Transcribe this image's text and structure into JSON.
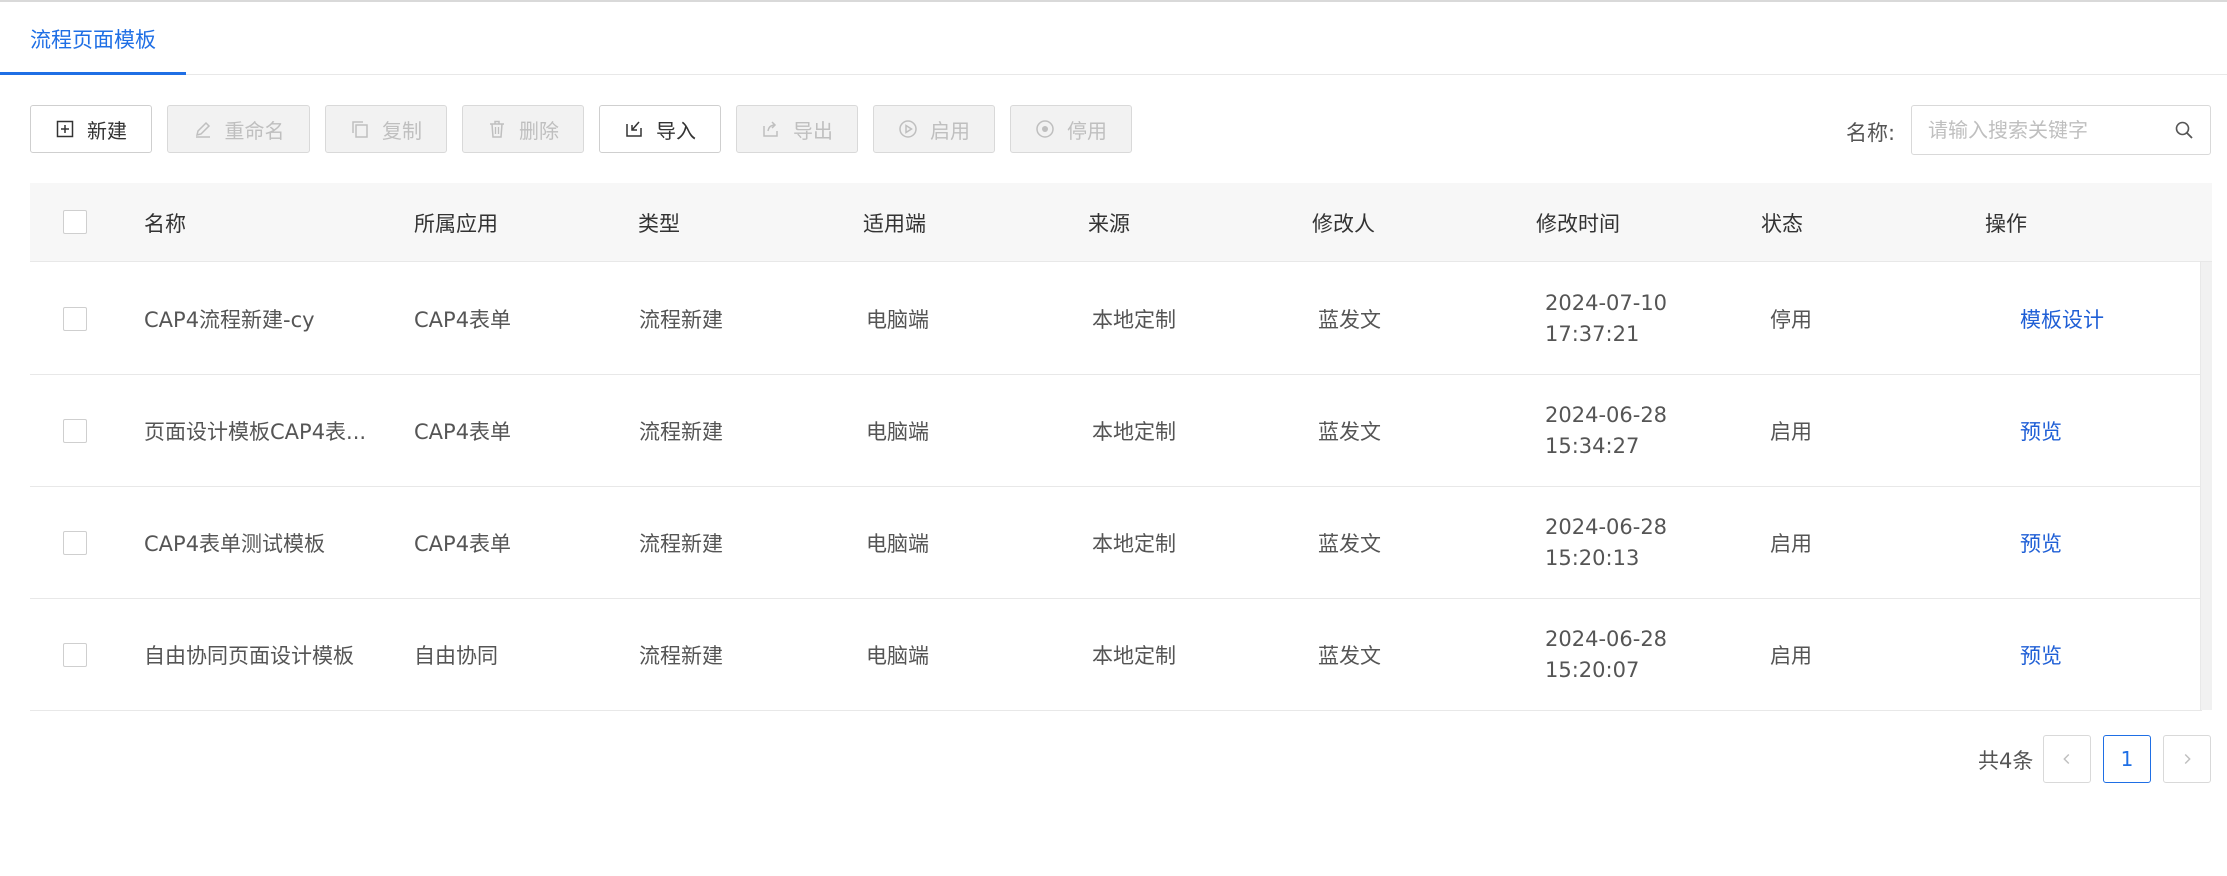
{
  "tabs": [
    {
      "label": "流程页面模板",
      "active": true
    }
  ],
  "toolbar": {
    "new_label": "新建",
    "rename_label": "重命名",
    "copy_label": "复制",
    "delete_label": "删除",
    "import_label": "导入",
    "export_label": "导出",
    "enable_label": "启用",
    "disable_label": "停用"
  },
  "search": {
    "label": "名称:",
    "placeholder": "请输入搜索关键字",
    "value": ""
  },
  "table": {
    "headers": {
      "name": "名称",
      "app": "所属应用",
      "type": "类型",
      "platform": "适用端",
      "source": "来源",
      "modifier": "修改人",
      "mtime": "修改时间",
      "status": "状态",
      "action": "操作"
    },
    "rows": [
      {
        "name": "CAP4流程新建-cy",
        "app": "CAP4表单",
        "type": "流程新建",
        "platform": "电脑端",
        "source": "本地定制",
        "modifier": "蓝发文",
        "date": "2024-07-10",
        "time": "17:37:21",
        "status": "停用",
        "action": "模板设计"
      },
      {
        "name": "页面设计模板CAP4表...",
        "app": "CAP4表单",
        "type": "流程新建",
        "platform": "电脑端",
        "source": "本地定制",
        "modifier": "蓝发文",
        "date": "2024-06-28",
        "time": "15:34:27",
        "status": "启用",
        "action": "预览"
      },
      {
        "name": "CAP4表单测试模板",
        "app": "CAP4表单",
        "type": "流程新建",
        "platform": "电脑端",
        "source": "本地定制",
        "modifier": "蓝发文",
        "date": "2024-06-28",
        "time": "15:20:13",
        "status": "启用",
        "action": "预览"
      },
      {
        "name": "自由协同页面设计模板",
        "app": "自由协同",
        "type": "流程新建",
        "platform": "电脑端",
        "source": "本地定制",
        "modifier": "蓝发文",
        "date": "2024-06-28",
        "time": "15:20:07",
        "status": "启用",
        "action": "预览"
      }
    ]
  },
  "pagination": {
    "total": "共4条",
    "current": "1",
    "prev_icon": "chevron-left-icon",
    "next_icon": "chevron-right-icon"
  },
  "colors": {
    "accent": "#1f6fe5",
    "link": "#1f5fd6",
    "disabled_bg": "#f2f2f2",
    "header_bg": "#f7f7f7"
  }
}
